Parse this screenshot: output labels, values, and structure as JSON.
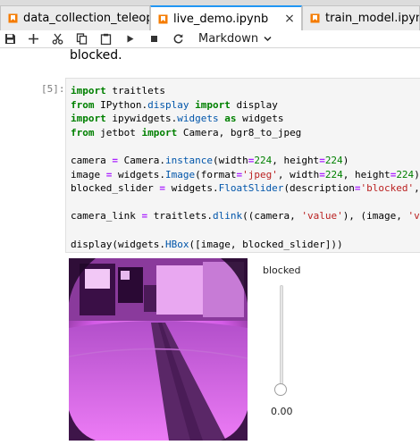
{
  "tabs": [
    {
      "label": "data_collection_teleoper",
      "icon": "notebook-icon",
      "active": false
    },
    {
      "label": "live_demo.ipynb",
      "icon": "notebook-icon",
      "active": true,
      "close": "×"
    },
    {
      "label": "train_model.ipynb",
      "icon": "notebook-icon",
      "active": false
    }
  ],
  "toolbar": {
    "buttons": [
      "save-icon",
      "add-cell-icon",
      "cut-icon",
      "copy-icon",
      "paste-icon",
      "run-icon",
      "stop-icon",
      "restart-icon"
    ],
    "cell_type": "Markdown"
  },
  "notebook": {
    "markdown_text": "blocked.",
    "prompt": "[5]:",
    "code_lines": [
      "import traitlets",
      "from IPython.display import display",
      "import ipywidgets.widgets as widgets",
      "from jetbot import Camera, bgr8_to_jpeg",
      "",
      "camera = Camera.instance(width=224, height=224)",
      "image = widgets.Image(format='jpeg', width=224, height=224)",
      "blocked_slider = widgets.FloatSlider(description='blocked', m",
      "",
      "camera_link = traitlets.dlink((camera, 'value'), (image, 'val",
      "",
      "display(widgets.HBox([image, blocked_slider]))"
    ]
  },
  "output": {
    "slider_description": "blocked",
    "slider_value_text": "0.00",
    "slider_value": 0.0
  },
  "colors": {
    "tab_accent": "#2196f3",
    "notebook_icon": "#f57c00",
    "image_tint": "#c24bd8"
  }
}
